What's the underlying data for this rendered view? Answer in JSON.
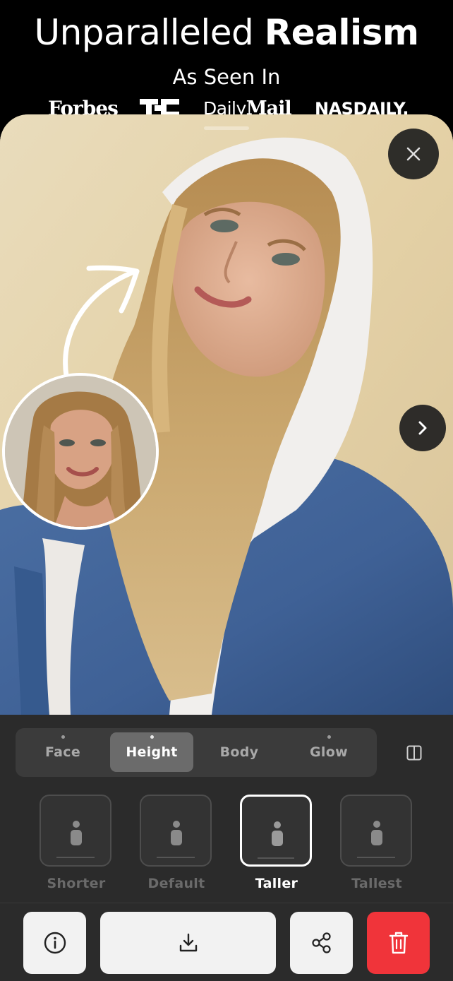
{
  "header": {
    "headline_light": "Unparalleled",
    "headline_bold": "Realism",
    "subheading": "As Seen In",
    "logos": {
      "forbes": "Forbes",
      "techcrunch": "TC",
      "dailymail_a": "Daily",
      "dailymail_b": "Mail",
      "nasdaily": "NASDAILY."
    }
  },
  "photo": {
    "close_icon": "close-icon",
    "next_icon": "chevron-right-icon"
  },
  "tabs": [
    {
      "label": "Face",
      "active": false
    },
    {
      "label": "Height",
      "active": true
    },
    {
      "label": "Body",
      "active": false
    },
    {
      "label": "Glow",
      "active": false
    }
  ],
  "compare_icon": "split-view-icon",
  "height_options": [
    {
      "label": "Shorter",
      "selected": false
    },
    {
      "label": "Default",
      "selected": false
    },
    {
      "label": "Taller",
      "selected": true
    },
    {
      "label": "Tallest",
      "selected": false
    }
  ],
  "toolbar": {
    "info_icon": "info-icon",
    "download_icon": "download-icon",
    "share_icon": "share-icon",
    "delete_icon": "trash-icon"
  },
  "colors": {
    "panel_bg": "#2b2b2b",
    "delete_red": "#f0343a",
    "button_light": "#f2f2f2"
  }
}
